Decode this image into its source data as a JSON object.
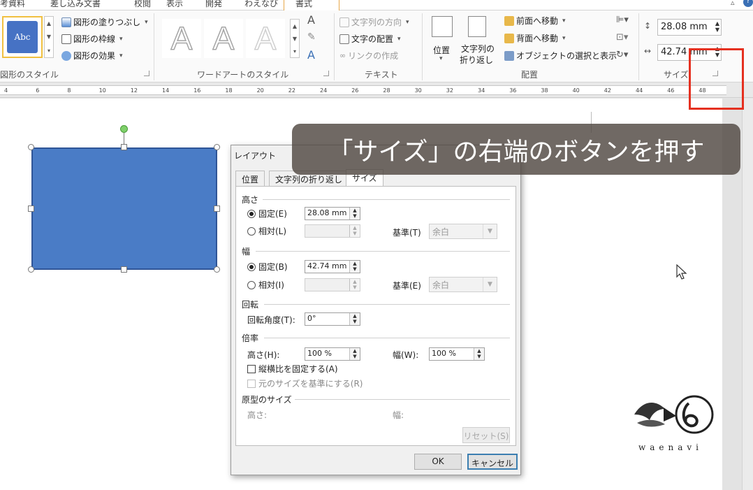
{
  "ribbon_tabs": [
    "考資料",
    "差し込み文書",
    "校閲",
    "表示",
    "開発",
    "わえなび",
    "書式"
  ],
  "active_tab": "書式",
  "groups": {
    "shape_styles": {
      "label": "図形のスタイル",
      "preview_text": "Abc",
      "fill": "図形の塗りつぶし",
      "outline": "図形の枠線",
      "effects": "図形の効果"
    },
    "wordart": {
      "label": "ワードアートのスタイル",
      "letters": [
        "A",
        "A",
        "A"
      ]
    },
    "text": {
      "label": "テキスト",
      "direction": "文字列の方向",
      "align": "文字の配置",
      "link": "リンクの作成"
    },
    "arrange": {
      "label": "配置",
      "position": "位置",
      "wrap_line1": "文字列の",
      "wrap_line2": "折り返し",
      "bring_forward": "前面へ移動",
      "send_backward": "背面へ移動",
      "selection_pane": "オブジェクトの選択と表示"
    },
    "size": {
      "label": "サイズ",
      "height": "28.08 mm",
      "width": "42.74 mm"
    }
  },
  "ruler_ticks": [
    "4",
    "6",
    "8",
    "10",
    "12",
    "14",
    "16",
    "18",
    "20",
    "22",
    "24",
    "26",
    "28",
    "30",
    "32",
    "34",
    "36",
    "38",
    "40",
    "42",
    "44",
    "46",
    "48"
  ],
  "callout": "「サイズ」の右端のボタンを押す",
  "dialog": {
    "title": "レイアウト",
    "tabs": [
      "位置",
      "文字列の折り返し",
      "サイズ"
    ],
    "active_tab": "サイズ",
    "height_section": "高さ",
    "height_fixed": "固定(E)",
    "height_value": "28.08 mm",
    "height_relative": "相対(L)",
    "height_base_label": "基準(T)",
    "height_base_value": "余白",
    "width_section": "幅",
    "width_fixed": "固定(B)",
    "width_value": "42.74 mm",
    "width_relative": "相対(I)",
    "width_base_label": "基準(E)",
    "width_base_value": "余白",
    "rotation_section": "回転",
    "rotation_label": "回転角度(T):",
    "rotation_value": "0°",
    "scale_section": "倍率",
    "scale_height_label": "高さ(H):",
    "scale_height_value": "100 %",
    "scale_width_label": "幅(W):",
    "scale_width_value": "100 %",
    "lock_aspect": "縦横比を固定する(A)",
    "relative_original": "元のサイズを基準にする(R)",
    "original_section": "原型のサイズ",
    "original_height": "高さ:",
    "original_width": "幅:",
    "reset": "リセット(S)",
    "ok": "OK",
    "cancel": "キャンセル"
  },
  "logo_text": "waenavi",
  "colors": {
    "shape_fill": "#4a7cc6",
    "highlight": "#e53020",
    "accent_tab": "#e8a84a"
  }
}
